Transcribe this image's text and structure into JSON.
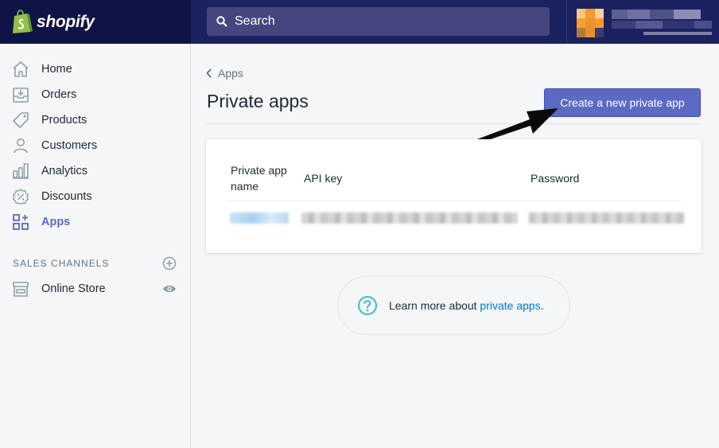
{
  "brand": {
    "name": "shopify"
  },
  "search": {
    "placeholder": "Search"
  },
  "sidebar": {
    "items": [
      {
        "label": "Home",
        "icon": "home-icon"
      },
      {
        "label": "Orders",
        "icon": "orders-icon"
      },
      {
        "label": "Products",
        "icon": "tag-icon"
      },
      {
        "label": "Customers",
        "icon": "person-icon"
      },
      {
        "label": "Analytics",
        "icon": "bar-chart-icon"
      },
      {
        "label": "Discounts",
        "icon": "discount-icon"
      },
      {
        "label": "Apps",
        "icon": "apps-icon",
        "active": true
      }
    ],
    "section_heading": "SALES CHANNELS",
    "channels": [
      {
        "label": "Online Store",
        "icon": "store-icon"
      }
    ]
  },
  "main": {
    "breadcrumb": "Apps",
    "title": "Private apps",
    "create_button": "Create a new private app",
    "table": {
      "headers": [
        "Private app name",
        "API key",
        "Password"
      ]
    },
    "learn_more": {
      "text": "Learn more about ",
      "link": "private apps",
      "suffix": "."
    }
  },
  "colors": {
    "topbar": "#1c2260",
    "brand_bg": "#0e1445",
    "accent": "#5c6ac4",
    "link": "#007ace",
    "help_icon": "#47c1bf"
  }
}
